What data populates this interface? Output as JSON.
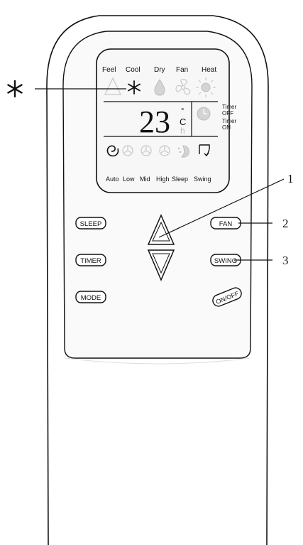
{
  "display": {
    "modes": [
      "Feel",
      "Cool",
      "Dry",
      "Fan",
      "Heat"
    ],
    "temperature": "23",
    "degree_symbol": "°",
    "unit_c": "C",
    "unit_h": "h",
    "timer_off_1": "Timer",
    "timer_off_2": "OFF",
    "timer_on_1": "Timer",
    "timer_on_2": "ON",
    "fan_speeds": [
      "Auto",
      "Low",
      "Mid",
      "High",
      "Sleep",
      "Swing"
    ]
  },
  "buttons": {
    "sleep": "SLEEP",
    "timer": "TIMER",
    "mode": "MODE",
    "fan": "FAN",
    "swing": "SWING",
    "onoff": "ON/OFF"
  },
  "callouts": {
    "one": "1",
    "two": "2",
    "three": "3",
    "snowflake_icon": "snowflake-icon"
  },
  "icons": [
    "feel-triangle-icon",
    "snowflake-icon",
    "drop-icon",
    "fan-icon",
    "sun-icon",
    "clock-icon",
    "auto-spiral-icon",
    "fan-low-icon",
    "fan-mid-icon",
    "fan-high-icon",
    "sleep-icon",
    "swing-icon",
    "up-arrow-icon",
    "down-arrow-icon"
  ]
}
